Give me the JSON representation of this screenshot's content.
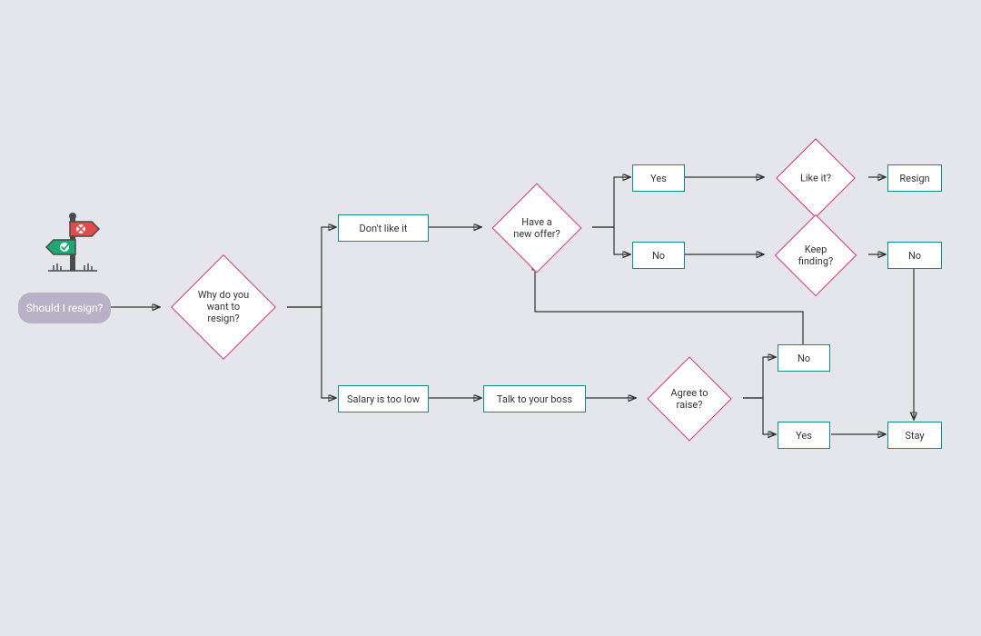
{
  "start": {
    "label": "Should I resign?"
  },
  "signpost": {
    "x_icon_name": "x-sign-icon",
    "check_icon_name": "check-sign-icon"
  },
  "nodes": {
    "why_resign": "Why do you\nwant to resign?",
    "dont_like": "Don't like it",
    "salary_low": "Salary is too low",
    "new_offer": "Have a\nnew offer?",
    "yes1": "Yes",
    "no1": "No",
    "like_it": "Like it?",
    "keep_finding": "Keep\nfinding?",
    "resign": "Resign",
    "no2": "No",
    "talk_boss": "Talk to your boss",
    "agree_raise": "Agree to\nraise?",
    "no3": "No",
    "yes2": "Yes",
    "stay": "Stay"
  },
  "colors": {
    "teal": "#0f8f8a",
    "magenta": "#d1307a",
    "start_bg": "#b9b2c6",
    "canvas_bg": "#e4e6eb"
  }
}
